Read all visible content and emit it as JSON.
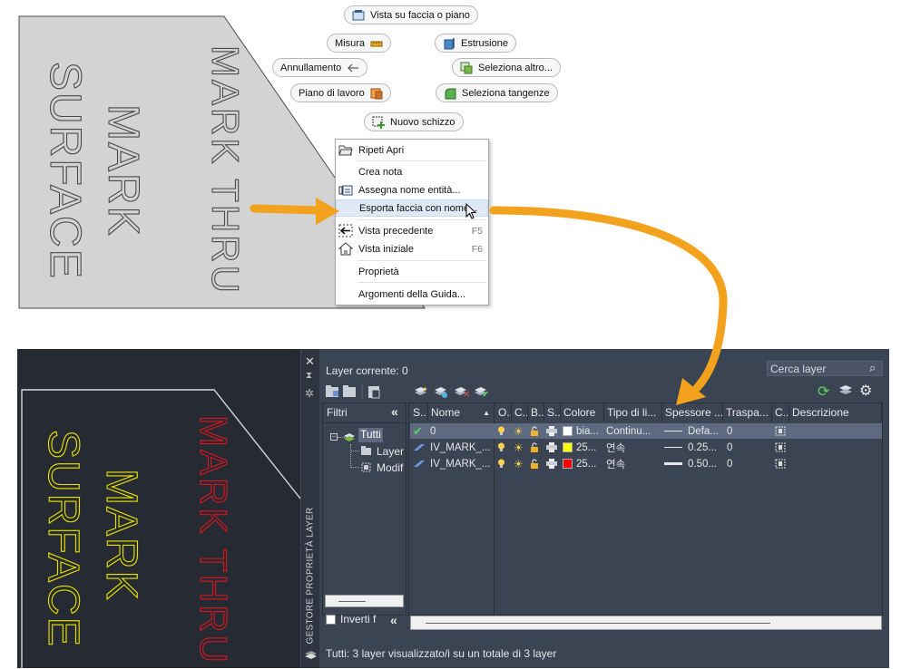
{
  "part_view": {
    "engraving_mark_surface": [
      "MARK",
      "SURFACE"
    ],
    "engraving_mark_thru": "MARK THRU"
  },
  "toolbar_pills": {
    "vista_faccia": "Vista su faccia o piano",
    "misura": "Misura",
    "estrusione": "Estrusione",
    "annullamento": "Annullamento",
    "seleziona_altro": "Seleziona altro...",
    "piano_lavoro": "Piano di lavoro",
    "seleziona_tangenze": "Seleziona tangenze",
    "nuovo_schizzo": "Nuovo schizzo"
  },
  "context_menu": {
    "items": [
      {
        "label": "Ripeti Apri",
        "shortcut": ""
      },
      {
        "label": "Crea nota",
        "shortcut": ""
      },
      {
        "label": "Assegna nome entità...",
        "shortcut": ""
      },
      {
        "label": "Esporta faccia con nome...",
        "shortcut": ""
      },
      {
        "label": "Vista precedente",
        "shortcut": "F5"
      },
      {
        "label": "Vista iniziale",
        "shortcut": "F6"
      },
      {
        "label": "Proprietà",
        "shortcut": ""
      },
      {
        "label": "Argomenti della Guida...",
        "shortcut": ""
      }
    ],
    "highlighted_index": 3
  },
  "acad_view": {
    "text_yellow": [
      "MARK",
      "SURFACE"
    ],
    "text_red": "MARK THRU"
  },
  "layer_manager": {
    "side_title": "GESTORE PROPRIETÀ LAYER",
    "current_layer": "Layer corrente: 0",
    "search_placeholder": "Cerca layer",
    "filters_title": "Filtri",
    "filter_tree": [
      "Tutti",
      "Layer",
      "Modif"
    ],
    "invert_label": "Inverti f",
    "columns": [
      "S..",
      "Nome",
      "O..",
      "C..",
      "B..",
      "S..",
      "Colore",
      "Tipo di li...",
      "Spessore ...",
      "Traspa...",
      "C..",
      "Descrizione"
    ],
    "rows": [
      {
        "name": "0",
        "color_label": "bia...",
        "color_hex": "#ffffff",
        "linetype": "Continu...",
        "lineweight": "Defa...",
        "transparency": "0",
        "current": true
      },
      {
        "name": "IV_MARK_...",
        "color_label": "25...",
        "color_hex": "#ffff00",
        "linetype": "연속",
        "lineweight": "0.25...",
        "transparency": "0",
        "current": false
      },
      {
        "name": "IV_MARK_...",
        "color_label": "25...",
        "color_hex": "#ff0000",
        "linetype": "연속",
        "lineweight": "0.50...",
        "transparency": "0",
        "current": false
      }
    ],
    "status_text": "Tutti: 3 layer visualizzato/i su un totale di 3 layer"
  },
  "colors": {
    "arrow": "#f2a21c",
    "palette_bg": "#3b4453",
    "selected_row": "#5d6a80",
    "engrave_yellow": "#e8e200",
    "engrave_red": "#e0141e"
  }
}
